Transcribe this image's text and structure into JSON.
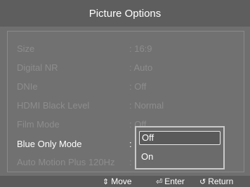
{
  "header": {
    "title": "Picture Options"
  },
  "menu": {
    "rows": [
      {
        "label": "Size",
        "value": ": 16:9"
      },
      {
        "label": "Digital NR",
        "value": ": Auto"
      },
      {
        "label": "DNIe",
        "value": ": Off"
      },
      {
        "label": "HDMI Black Level",
        "value": ": Normal"
      },
      {
        "label": "Film Mode",
        "value": ": Off"
      },
      {
        "label": "Blue Only Mode",
        "value": ":"
      },
      {
        "label": "Auto Motion Plus 120Hz",
        "value": ":"
      }
    ],
    "active_index": 5
  },
  "dropdown": {
    "options": [
      {
        "label": "Off",
        "selected": true
      },
      {
        "label": "On",
        "selected": false
      }
    ]
  },
  "footer": {
    "move": {
      "icon": "updown-arrow-icon",
      "label": "Move"
    },
    "enter": {
      "icon": "enter-icon",
      "label": "Enter"
    },
    "return": {
      "icon": "return-icon",
      "label": "Return"
    }
  }
}
